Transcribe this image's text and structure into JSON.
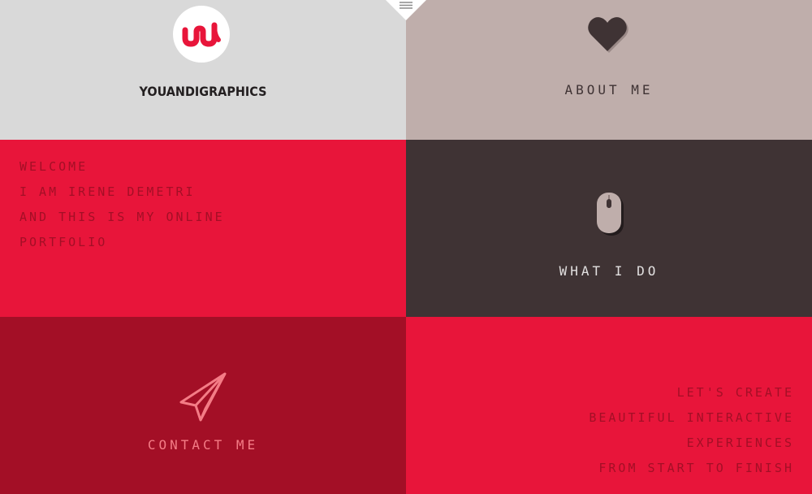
{
  "logo": {
    "brand_name": "YOUANDIGRAPHICS",
    "monogram": "ul"
  },
  "about": {
    "label": "ABOUT ME",
    "icon": "heart-icon"
  },
  "welcome": {
    "lines": [
      "WELCOME",
      "I AM IRENE DEMETRI",
      "AND THIS IS MY ONLINE",
      "PORTFOLIO"
    ]
  },
  "whatido": {
    "label": "WHAT I DO",
    "icon": "mouse-icon"
  },
  "contact": {
    "label": "CONTACT ME",
    "icon": "paper-plane-icon"
  },
  "tagline": {
    "lines": [
      "LET'S CREATE",
      "BEAUTIFUL INTERACTIVE",
      "EXPERIENCES",
      "FROM START TO FINISH"
    ]
  },
  "menu": {
    "icon": "hamburger-menu-icon"
  },
  "colors": {
    "light_gray": "#d9d9d9",
    "taupe": "#bfaeab",
    "red": "#e8153a",
    "dark_brown": "#3f3334",
    "dark_red": "#a30f26",
    "pink": "#f47c86"
  }
}
